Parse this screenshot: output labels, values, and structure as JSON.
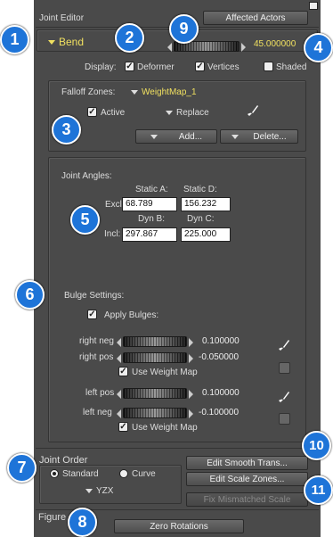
{
  "header": {
    "title": "Joint Editor",
    "affected_actors": "Affected Actors"
  },
  "bend": {
    "label": "Bend",
    "value": "45.000000"
  },
  "display": {
    "label": "Display:",
    "deformer": "Deformer",
    "vertices": "Vertices",
    "shaded": "Shaded"
  },
  "falloff": {
    "label": "Falloff Zones:",
    "map": "WeightMap_1",
    "active": "Active",
    "replace": "Replace",
    "add": "Add...",
    "delete": "Delete..."
  },
  "angles": {
    "label": "Joint Angles:",
    "static_a": "Static A:",
    "static_d": "Static D:",
    "excl": "Excl:",
    "excl_a": "68.789",
    "excl_d": "156.232",
    "dyn_b": "Dyn B:",
    "dyn_c": "Dyn C:",
    "incl": "Incl:",
    "incl_b": "297.867",
    "incl_c": "225.000"
  },
  "bulge": {
    "label": "Bulge Settings:",
    "apply": "Apply Bulges:",
    "right_neg": "right neg",
    "right_neg_val": "0.100000",
    "right_pos": "right pos",
    "right_pos_val": "-0.050000",
    "use_weight_map": "Use Weight Map",
    "left_pos": "left pos",
    "left_pos_val": "0.100000",
    "left_neg": "left neg",
    "left_neg_val": "-0.100000",
    "use_weight_map2": "Use Weight Map"
  },
  "order": {
    "label": "Joint Order",
    "standard": "Standard",
    "curve": "Curve",
    "axis": "YZX"
  },
  "buttons": {
    "smooth": "Edit Smooth Trans...",
    "scale": "Edit Scale Zones...",
    "fix": "Fix Mismatched Scale"
  },
  "figure": {
    "label": "Figure",
    "zero": "Zero Rotations"
  },
  "badges": [
    "1",
    "2",
    "3",
    "4",
    "5",
    "6",
    "7",
    "8",
    "9",
    "10",
    "11"
  ]
}
